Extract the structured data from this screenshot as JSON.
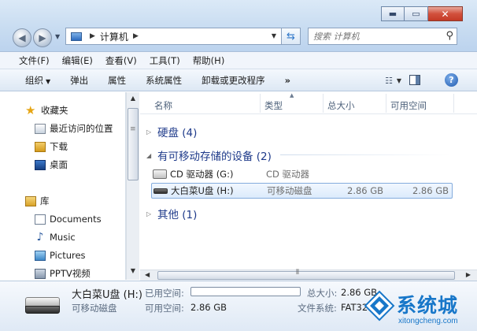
{
  "window_controls": {
    "minimize": "▬",
    "maximize": "▭",
    "close": "✕"
  },
  "address": {
    "path": [
      "计算机"
    ]
  },
  "search": {
    "placeholder": "搜索 计算机"
  },
  "menu": [
    "文件(F)",
    "编辑(E)",
    "查看(V)",
    "工具(T)",
    "帮助(H)"
  ],
  "commands": {
    "organize": "组织",
    "eject": "弹出",
    "properties": "属性",
    "system_properties": "系统属性",
    "uninstall": "卸载或更改程序",
    "more": "»"
  },
  "nav": {
    "favorites": "收藏夹",
    "recent": "最近访问的位置",
    "downloads": "下载",
    "desktop": "桌面",
    "library": "库",
    "documents": "Documents",
    "music": "Music",
    "pictures": "Pictures",
    "pptv": "PPTV视频"
  },
  "columns": {
    "name": "名称",
    "type": "类型",
    "total": "总大小",
    "free": "可用空间"
  },
  "groups": {
    "hdd": "硬盘 (4)",
    "removable": "有可移动存储的设备 (2)",
    "other": "其他 (1)"
  },
  "drives": [
    {
      "name": "CD 驱动器 (G:)",
      "type": "CD 驱动器",
      "total": "",
      "free": ""
    },
    {
      "name": "大白菜U盘 (H:)",
      "type": "可移动磁盘",
      "total": "2.86 GB",
      "free": "2.86 GB"
    }
  ],
  "details": {
    "name": "大白菜U盘 (H:)",
    "kind": "可移动磁盘",
    "used_label": "已用空间:",
    "used_fraction": 0.0,
    "free_label": "可用空间:",
    "free_value": "2.86 GB",
    "total_label": "总大小:",
    "total_value": "2.86 GB",
    "fs_label": "文件系统:",
    "fs_value": "FAT32"
  },
  "watermark": {
    "brand": "系统城",
    "url": "xitongcheng.com"
  },
  "colors": {
    "accent": "#1e3a8a",
    "selection_border": "#84acdd",
    "watermark": "#1877c9"
  }
}
